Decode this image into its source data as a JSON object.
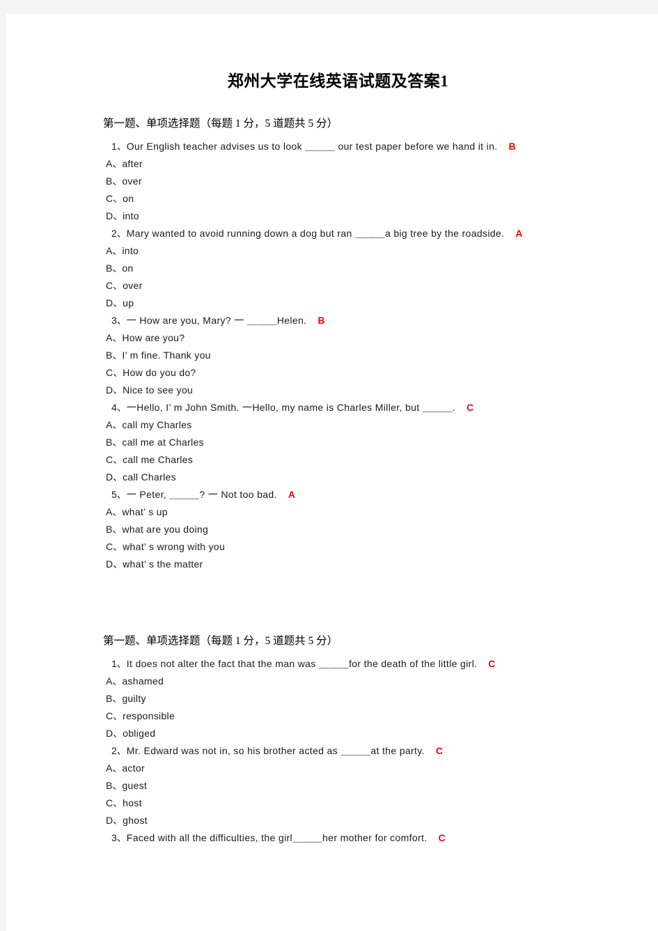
{
  "document": {
    "title": "郑州大学在线英语试题及答案1",
    "answer_color": "#ff0000",
    "text_color": "#1a1a1a",
    "page_background": "#ffffff",
    "canvas_background": "#f4f4f4"
  },
  "sections": [
    {
      "header": "第一题、单项选择题（每题 1 分，5 道题共 5 分）",
      "questions": [
        {
          "number": "1、",
          "text": "Our  English  teacher  advises  us  to  look   ＿＿＿  our  test  paper  before  we  hand  it  in.",
          "answer": "B",
          "options": [
            {
              "letter": "A、",
              "text": "after"
            },
            {
              "letter": "B、",
              "text": "over"
            },
            {
              "letter": "C、",
              "text": "on"
            },
            {
              "letter": "D、",
              "text": "into"
            }
          ]
        },
        {
          "number": "2、",
          "text": "Mary  wanted  to  avoid  running  down  a  dog  but  ran   ＿＿＿a  big  tree  by  the  roadside.",
          "answer": "A",
          "options": [
            {
              "letter": "A、",
              "text": "into"
            },
            {
              "letter": "B、",
              "text": "on"
            },
            {
              "letter": "C、",
              "text": "over"
            },
            {
              "letter": "D、",
              "text": "up"
            }
          ]
        },
        {
          "number": "3、",
          "text": "一  How  are  you,  Mary?   一  ＿＿＿Helen.",
          "answer": "B",
          "options": [
            {
              "letter": "A、",
              "text": "How  are  you?"
            },
            {
              "letter": "B、",
              "text": "I’ m fine. Thank you"
            },
            {
              "letter": "C、",
              "text": "How  do  you  do?"
            },
            {
              "letter": "D、",
              "text": "Nice  to  see  you"
            }
          ]
        },
        {
          "number": "4、",
          "text": "一Hello,  I’ m John Smith.   一Hello,  my  name  is  Charles  Miller,  but ＿＿＿.",
          "answer": "C",
          "options": [
            {
              "letter": "A、",
              "text": "call  my  Charles"
            },
            {
              "letter": "B、",
              "text": "call  me  at  Charles"
            },
            {
              "letter": "C、",
              "text": "call  me  Charles"
            },
            {
              "letter": "D、",
              "text": "call  Charles"
            }
          ]
        },
        {
          "number": "5、",
          "text": "一  Peter,   ＿＿＿?  一  Not  too  bad.",
          "answer": "A",
          "options": [
            {
              "letter": "A、",
              "text": "what’ s up"
            },
            {
              "letter": "B、",
              "text": "what  are  you  doing"
            },
            {
              "letter": "C、",
              "text": "what’ s  wrong  with  you"
            },
            {
              "letter": "D、",
              "text": "what’ s the matter"
            }
          ]
        }
      ]
    },
    {
      "header": "第一题、单项选择题（每题 1 分，5 道题共 5 分）",
      "questions": [
        {
          "number": "1、",
          "text": "It  does  not  alter  the  fact  that  the  man  was   ＿＿＿for  the  death  of  the  little  girl.",
          "answer": "C",
          "options": [
            {
              "letter": "A、",
              "text": "ashamed"
            },
            {
              "letter": "B、",
              "text": "guilty"
            },
            {
              "letter": "C、",
              "text": "responsible"
            },
            {
              "letter": "D、",
              "text": "obliged"
            }
          ]
        },
        {
          "number": "2、",
          "text": "Mr.  Edward  was  not  in,  so  his  brother  acted  as   ＿＿＿at  the  party.",
          "answer": "C",
          "options": [
            {
              "letter": "A、",
              "text": "actor"
            },
            {
              "letter": "B、",
              "text": "guest"
            },
            {
              "letter": "C、",
              "text": "host"
            },
            {
              "letter": "D、",
              "text": "ghost"
            }
          ]
        },
        {
          "number": "3、",
          "text": "Faced  with  all  the  difficulties,  the  girl＿＿＿her  mother  for  comfort.",
          "answer": "C",
          "options": []
        }
      ]
    }
  ]
}
